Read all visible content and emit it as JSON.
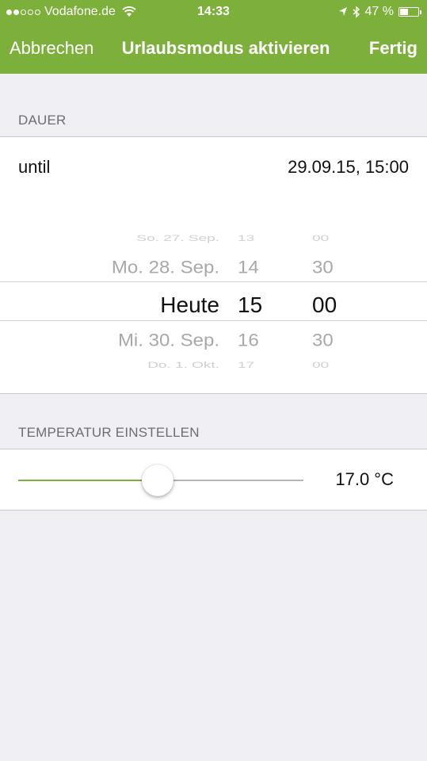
{
  "status_bar": {
    "carrier": "Vodafone.de",
    "time": "14:33",
    "battery_text": "47 %",
    "battery_level": 0.47,
    "signal_full": 2,
    "signal_total": 5
  },
  "nav": {
    "left_label": "Abbrechen",
    "title": "Urlaubsmodus aktivieren",
    "right_label": "Fertig"
  },
  "duration": {
    "section_header": "DAUER",
    "until_label": "until",
    "until_value": "29.09.15, 15:00",
    "picker": {
      "rows": [
        {
          "day": "So. 27. Sep.",
          "hour": "13",
          "minute": "00"
        },
        {
          "day": "Mo. 28. Sep.",
          "hour": "14",
          "minute": "30"
        },
        {
          "day": "Heute",
          "hour": "15",
          "minute": "00"
        },
        {
          "day": "Mi. 30. Sep.",
          "hour": "16",
          "minute": "30"
        },
        {
          "day": "Do. 1. Okt.",
          "hour": "17",
          "minute": "00"
        }
      ],
      "selected_index": 2
    }
  },
  "temperature": {
    "section_header": "TEMPERATUR EINSTELLEN",
    "value_text": "17.0 °C",
    "slider_fraction": 0.49
  },
  "colors": {
    "accent": "#7cb03a",
    "background": "#efeff4"
  }
}
